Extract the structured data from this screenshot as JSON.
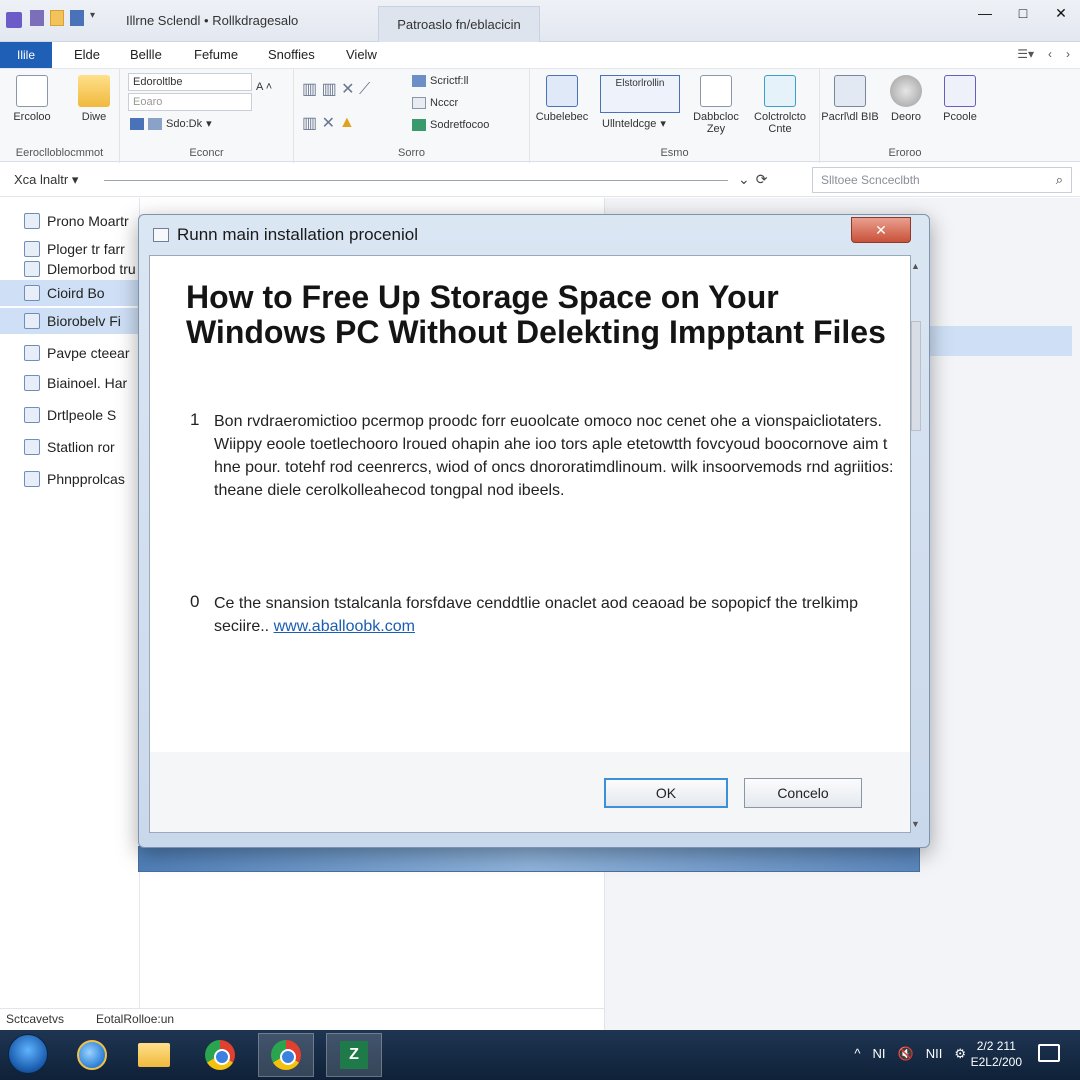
{
  "window": {
    "title": "Illrne  Sclendl  • Rollkdragesalo",
    "active_tab": "Patroaslo fn/eblacicin",
    "controls": {
      "minimize": "—",
      "maximize": "□",
      "close": "✕"
    }
  },
  "menu": {
    "file": "Ilile",
    "tabs": [
      "Elde",
      "Bellle",
      "Fefume",
      "Snoffies",
      "Vielw"
    ]
  },
  "ribbon": {
    "groups": [
      {
        "label": "Eeroclloblocmmot",
        "buttons": [
          "Ercoloo",
          "Diwe"
        ]
      },
      {
        "label": "Econcr",
        "font_name": "Edoroltlbe",
        "font_size": "Eoaro",
        "style_label": "Sdo:Dk"
      },
      {
        "label": "Sorro",
        "items": [
          "Scrictf:ll",
          "Ncccr",
          "Sodretfocoo"
        ]
      },
      {
        "label": "Esmo",
        "buttons": [
          "Cubelebec",
          "Ullnteldcge",
          "Dabbcloc Zey",
          "Colctrolcto Cnte"
        ],
        "preview_label": "Elstorlrollin"
      },
      {
        "label": "Eroroo",
        "buttons": [
          "Pacrl\\dl BIB",
          "Deoro",
          "Pcoole"
        ]
      }
    ]
  },
  "address": {
    "back_label": "Xca lnaltr",
    "search_placeholder": "Slltoee Scnceclbth"
  },
  "nav": {
    "items": [
      {
        "label": "Prono Moartr",
        "selected": false
      },
      {
        "label": "Ploger tr farr",
        "selected": false
      },
      {
        "label": "Dlemorbod tru",
        "selected": false
      },
      {
        "label": "Cioird Bo",
        "selected": true
      },
      {
        "label": "Biorobelv Fi",
        "selected": true
      },
      {
        "label": "Pavpe cteear",
        "selected": false
      },
      {
        "label": "Biainoel. Har",
        "selected": false
      },
      {
        "label": "Drtlpeole S",
        "selected": false
      },
      {
        "label": "Statlion ror",
        "selected": false
      },
      {
        "label": "Phnpprolcas",
        "selected": false
      }
    ]
  },
  "status": {
    "left": "Sctcavetvs",
    "mid": "EotalRolloe:un"
  },
  "dialog": {
    "title": "Runn main installation proceniol",
    "close_label": "✕",
    "heading": "How to Free Up Storage Space on Your Windows PC Without Delekting Impptant Files",
    "items": [
      {
        "number": "1",
        "line1": "Bon rvdraeromictioo pcermop proodc forr euoolcate omoco noc cenet ohe a vionspaicliotaters.",
        "line2": "Wiippy eoole toetlechooro lroued ohapin ahe ioo tors aple etetowtth fovcyoud boocornove aim t hne pour. totehf rod ceenrercs, wiod of oncs dnororatimdlinoum. wilk insoorvemods rnd agriitios: theane diele cerolkolleahecod tongpal nod ibeels."
      },
      {
        "number": "0",
        "text": "Ce the snansion tstalcanla forsfdave cenddtlie onaclet aod ceaoad be sopopicf the trelkimp seciire..",
        "link": "www.aballoobk.com"
      }
    ],
    "ok_label": "OK",
    "cancel_label": "Concelo"
  },
  "taskbar": {
    "tray_icons": [
      "^",
      "NI",
      "🔇",
      "NII",
      "⚙"
    ],
    "clock_time": "2/2 211",
    "clock_date": "E2L2/200"
  }
}
